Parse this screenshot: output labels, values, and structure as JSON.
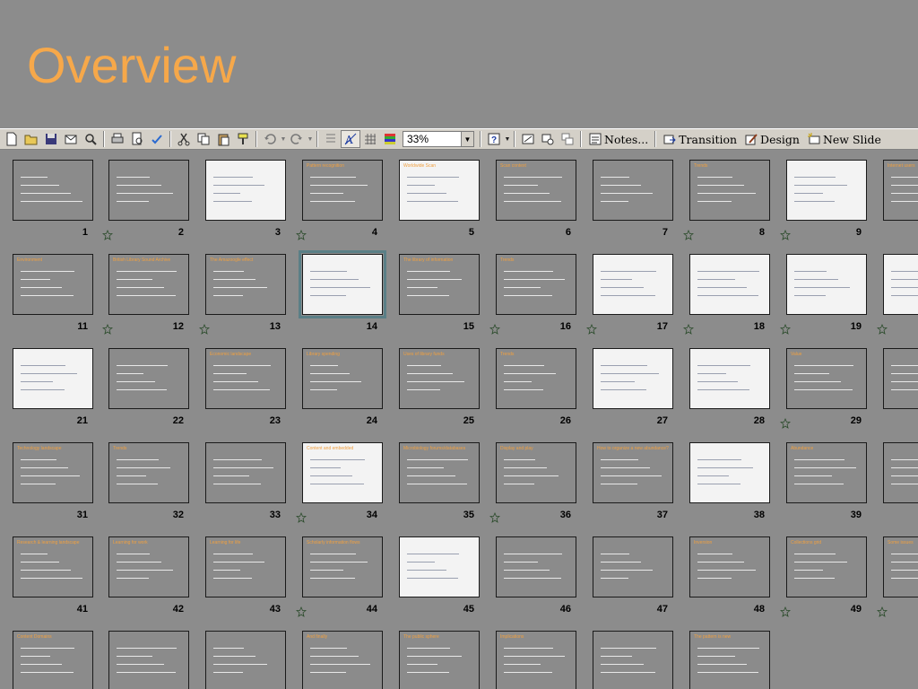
{
  "title": "Overview",
  "toolbar": {
    "zoom": "33%",
    "notes_label": "Notes...",
    "transition_label": "Transition",
    "design_label": "Design",
    "new_slide_label": "New Slide"
  },
  "slides": [
    {
      "n": "1",
      "title": "",
      "trans": false
    },
    {
      "n": "2",
      "title": "",
      "trans": true
    },
    {
      "n": "3",
      "title": "",
      "trans": false
    },
    {
      "n": "4",
      "title": "Pattern recognition",
      "trans": true
    },
    {
      "n": "5",
      "title": "Worldwide Scan",
      "trans": false
    },
    {
      "n": "6",
      "title": "Scan context",
      "trans": false
    },
    {
      "n": "7",
      "title": "",
      "trans": false
    },
    {
      "n": "8",
      "title": "Trends",
      "trans": true
    },
    {
      "n": "9",
      "title": "",
      "trans": true
    },
    {
      "n": "",
      "title": "Internet users",
      "trans": false
    },
    {
      "n": "11",
      "title": "Environment",
      "trans": false
    },
    {
      "n": "12",
      "title": "British Library Sound Archive",
      "trans": true
    },
    {
      "n": "13",
      "title": "The Amazoogle effect",
      "trans": true
    },
    {
      "n": "14",
      "title": "",
      "trans": false
    },
    {
      "n": "15",
      "title": "The library of information",
      "trans": false
    },
    {
      "n": "16",
      "title": "Trends",
      "trans": true
    },
    {
      "n": "17",
      "title": "",
      "trans": true
    },
    {
      "n": "18",
      "title": "",
      "trans": true
    },
    {
      "n": "19",
      "title": "",
      "trans": true
    },
    {
      "n": "",
      "title": "",
      "trans": true
    },
    {
      "n": "21",
      "title": "",
      "trans": false
    },
    {
      "n": "22",
      "title": "",
      "trans": false
    },
    {
      "n": "23",
      "title": "Economic landscape",
      "trans": false
    },
    {
      "n": "24",
      "title": "Library spending",
      "trans": false
    },
    {
      "n": "25",
      "title": "Uses of library funds",
      "trans": false
    },
    {
      "n": "26",
      "title": "Trends",
      "trans": false
    },
    {
      "n": "27",
      "title": "",
      "trans": false
    },
    {
      "n": "28",
      "title": "",
      "trans": false
    },
    {
      "n": "29",
      "title": "Value",
      "trans": true
    },
    {
      "n": "",
      "title": "",
      "trans": false
    },
    {
      "n": "31",
      "title": "Technology landscape",
      "trans": false
    },
    {
      "n": "32",
      "title": "Trends",
      "trans": false
    },
    {
      "n": "33",
      "title": "",
      "trans": false
    },
    {
      "n": "34",
      "title": "Content and embedded",
      "trans": true
    },
    {
      "n": "35",
      "title": "Microbiology forums/databases",
      "trans": false
    },
    {
      "n": "36",
      "title": "Display and play",
      "trans": true
    },
    {
      "n": "37",
      "title": "How to organize a new abundance?",
      "trans": false
    },
    {
      "n": "38",
      "title": "",
      "trans": false
    },
    {
      "n": "39",
      "title": "Abundance",
      "trans": false
    },
    {
      "n": "",
      "title": "",
      "trans": false
    },
    {
      "n": "41",
      "title": "Research & learning landscape",
      "trans": false
    },
    {
      "n": "42",
      "title": "Learning for work",
      "trans": false
    },
    {
      "n": "43",
      "title": "Learning for life",
      "trans": false
    },
    {
      "n": "44",
      "title": "Scholarly information flows",
      "trans": true
    },
    {
      "n": "45",
      "title": "",
      "trans": false
    },
    {
      "n": "46",
      "title": "",
      "trans": false
    },
    {
      "n": "47",
      "title": "",
      "trans": false
    },
    {
      "n": "48",
      "title": "Inversion",
      "trans": false
    },
    {
      "n": "49",
      "title": "Collections grid",
      "trans": true
    },
    {
      "n": "",
      "title": "Some issues",
      "trans": true
    },
    {
      "n": "",
      "title": "Content Domains",
      "trans": false
    },
    {
      "n": "",
      "title": "",
      "trans": false
    },
    {
      "n": "",
      "title": "",
      "trans": false
    },
    {
      "n": "",
      "title": "And finally",
      "trans": false
    },
    {
      "n": "",
      "title": "The public sphere",
      "trans": false
    },
    {
      "n": "",
      "title": "Implications",
      "trans": false
    },
    {
      "n": "",
      "title": "",
      "trans": false
    },
    {
      "n": "",
      "title": "The pattern is new",
      "trans": false
    }
  ],
  "slide_number_labels": [
    "1",
    "2",
    "3",
    "4",
    "5",
    "6",
    "7",
    "8",
    "9",
    "11",
    "12",
    "13",
    "14",
    "15",
    "16",
    "17",
    "18",
    "19",
    "21",
    "22",
    "23",
    "24",
    "25",
    "26",
    "27",
    "28",
    "29",
    "31",
    "32",
    "33",
    "34",
    "35",
    "36",
    "37",
    "38",
    "39",
    "41",
    "42",
    "43",
    "44",
    "45",
    "46",
    "47",
    "48",
    "49"
  ]
}
